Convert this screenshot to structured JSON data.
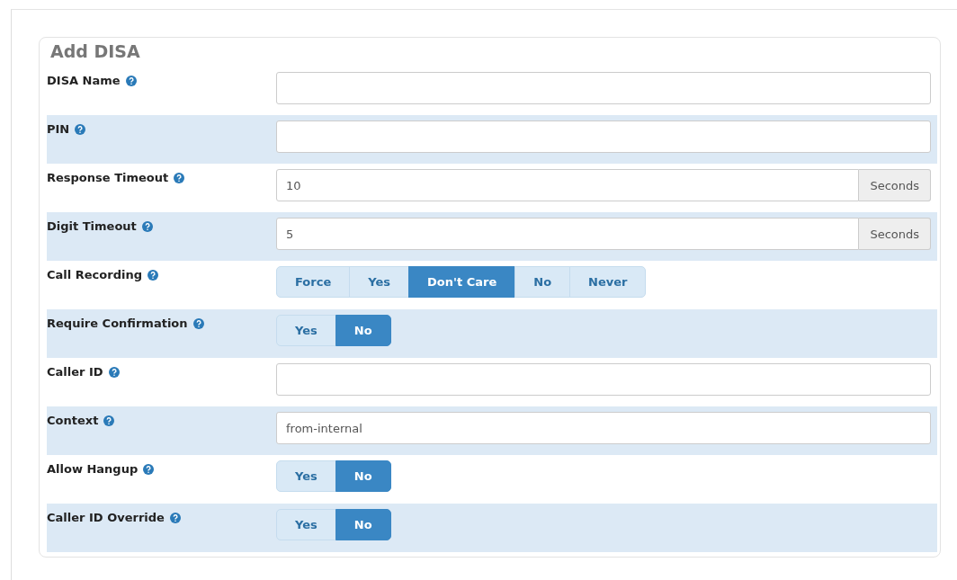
{
  "title": "Add DISA",
  "fields": [
    {
      "kind": "text",
      "label": "DISA Name"
    },
    {
      "kind": "text",
      "label": "PIN"
    },
    {
      "kind": "addon",
      "label": "Response Timeout",
      "value": "10",
      "addon": "Seconds"
    },
    {
      "kind": "addon",
      "label": "Digit Timeout",
      "value": "5",
      "addon": "Seconds"
    },
    {
      "kind": "radio",
      "label": "Call Recording",
      "options": [
        {
          "label": "Force",
          "selected": false
        },
        {
          "label": "Yes",
          "selected": false
        },
        {
          "label": "Don't Care",
          "selected": true
        },
        {
          "label": "No",
          "selected": false
        },
        {
          "label": "Never",
          "selected": false
        }
      ]
    },
    {
      "kind": "radio",
      "label": "Require Confirmation",
      "options": [
        {
          "label": "Yes",
          "selected": false
        },
        {
          "label": "No",
          "selected": true
        }
      ]
    },
    {
      "kind": "text",
      "label": "Caller ID"
    },
    {
      "kind": "text",
      "label": "Context",
      "value": "from-internal"
    },
    {
      "kind": "radio",
      "label": "Allow Hangup",
      "options": [
        {
          "label": "Yes",
          "selected": false
        },
        {
          "label": "No",
          "selected": true
        }
      ]
    },
    {
      "kind": "radio",
      "label": "Caller ID Override",
      "options": [
        {
          "label": "Yes",
          "selected": false
        },
        {
          "label": "No",
          "selected": true
        }
      ]
    }
  ]
}
